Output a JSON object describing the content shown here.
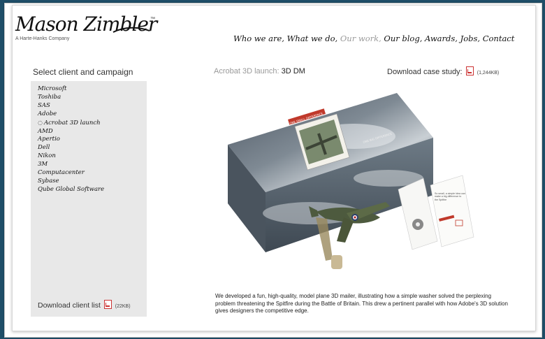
{
  "logo": {
    "script": "Mason Zimbler",
    "tm": "™",
    "subtitle": "A Harte-Hanks Company"
  },
  "nav": {
    "items": [
      {
        "label": "Who we are,"
      },
      {
        "label": "What we do,"
      },
      {
        "label": "Our work,"
      },
      {
        "label": "Our blog,"
      },
      {
        "label": "Awards,"
      },
      {
        "label": "Jobs,"
      },
      {
        "label": "Contact"
      }
    ],
    "active_color": "#9a9a9a"
  },
  "sidebar": {
    "title": "Select client and campaign",
    "clients": [
      {
        "label": "Microsoft"
      },
      {
        "label": "Toshiba"
      },
      {
        "label": "SAS"
      },
      {
        "label": "Adobe"
      },
      {
        "label": "Acrobat 3D launch",
        "pin": "◌"
      },
      {
        "label": "AMD"
      },
      {
        "label": "Apertio"
      },
      {
        "label": "Dell"
      },
      {
        "label": "Nikon"
      },
      {
        "label": "3M"
      },
      {
        "label": "Computacenter"
      },
      {
        "label": "Sybase"
      },
      {
        "label": "Qube Global Software"
      }
    ],
    "download_label": "Download client list",
    "download_size": "(22KB)"
  },
  "campaign": {
    "prefix": "Acrobat 3D launch:",
    "name": "3D DM"
  },
  "case_study": {
    "label": "Download case study:",
    "size": "(1,244KB)"
  },
  "hero": {
    "box_label": "ONE SMALL DIFFERENCE",
    "box_side_label": "ONE BIG DIFFERENCE",
    "card_text": "So small, a simple idea can make a big difference to the Spitfire"
  },
  "description": "We developed a fun, high-quality, model plane 3D mailer, illustrating how a simple washer solved the perplexing problem threatening the Spitfire during the Battle of Britain. This drew a pertinent parallel with how Adobe's 3D solution gives designers the competitive edge.",
  "colors": {
    "background": "#1f4e68",
    "panel": "#e8e8e8",
    "pdf_red": "#cc3333"
  }
}
